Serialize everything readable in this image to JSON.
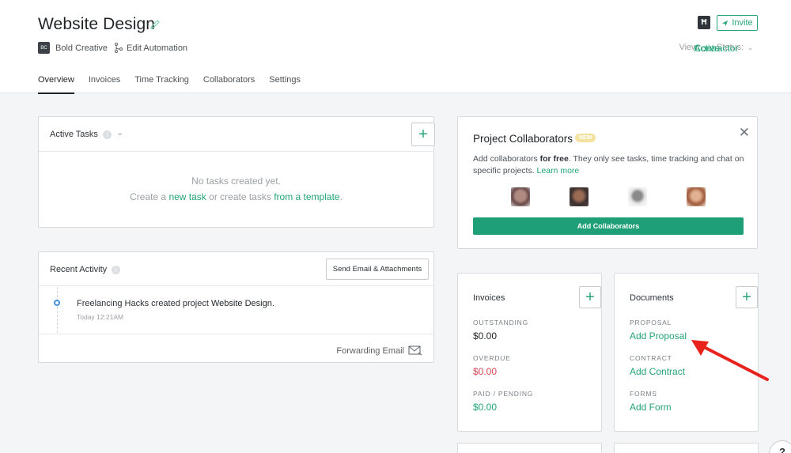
{
  "header": {
    "title": "Website Design",
    "client_initials": "BC",
    "client_name": "Bold Creative",
    "automation_label": "Edit Automation",
    "logo_glyph": "Ħ",
    "invite_label": "Invite",
    "view_label": "View:",
    "view_value": "Contractor",
    "status_label": "Status:",
    "status_value": "Active"
  },
  "tabs": [
    {
      "label": "Overview"
    },
    {
      "label": "Invoices"
    },
    {
      "label": "Time Tracking"
    },
    {
      "label": "Collaborators"
    },
    {
      "label": "Settings"
    }
  ],
  "tasks": {
    "title": "Active Tasks",
    "empty_line": "No tasks created yet.",
    "create_prefix": "Create a",
    "new_task_link": "new task",
    "create_middle": "or create tasks",
    "template_link": "from a template",
    "create_suffix": "."
  },
  "activity": {
    "title": "Recent Activity",
    "send_button": "Send Email & Attachments",
    "item_prefix": "Freelancing Hacks created project",
    "item_project": "Website Design",
    "item_suffix": ".",
    "item_time": "Today 12:21AM",
    "forwarding_label": "Forwarding Email"
  },
  "collaborators": {
    "title": "Project Collaborators",
    "badge": "NEW",
    "desc_prefix": "Add collaborators",
    "desc_bold": "for free",
    "desc_rest": ". They only see tasks, time tracking and chat on specific projects.",
    "learn_more": "Learn more",
    "add_button": "Add Collaborators"
  },
  "invoices": {
    "title": "Invoices",
    "outstanding_label": "OUTSTANDING",
    "outstanding_value": "$0.00",
    "overdue_label": "OVERDUE",
    "overdue_value": "$0.00",
    "paid_label": "PAID / PENDING",
    "paid_value": "$0.00"
  },
  "documents": {
    "title": "Documents",
    "proposal_label": "PROPOSAL",
    "proposal_link": "Add Proposal",
    "contract_label": "CONTRACT",
    "contract_link": "Add Contract",
    "forms_label": "FORMS",
    "forms_link": "Add Form"
  },
  "help_glyph": "?",
  "colors": {
    "accent": "#23a477",
    "button_green": "#1e9f77",
    "overdue_red": "#d64553",
    "annotation_arrow": "#e8231e"
  }
}
